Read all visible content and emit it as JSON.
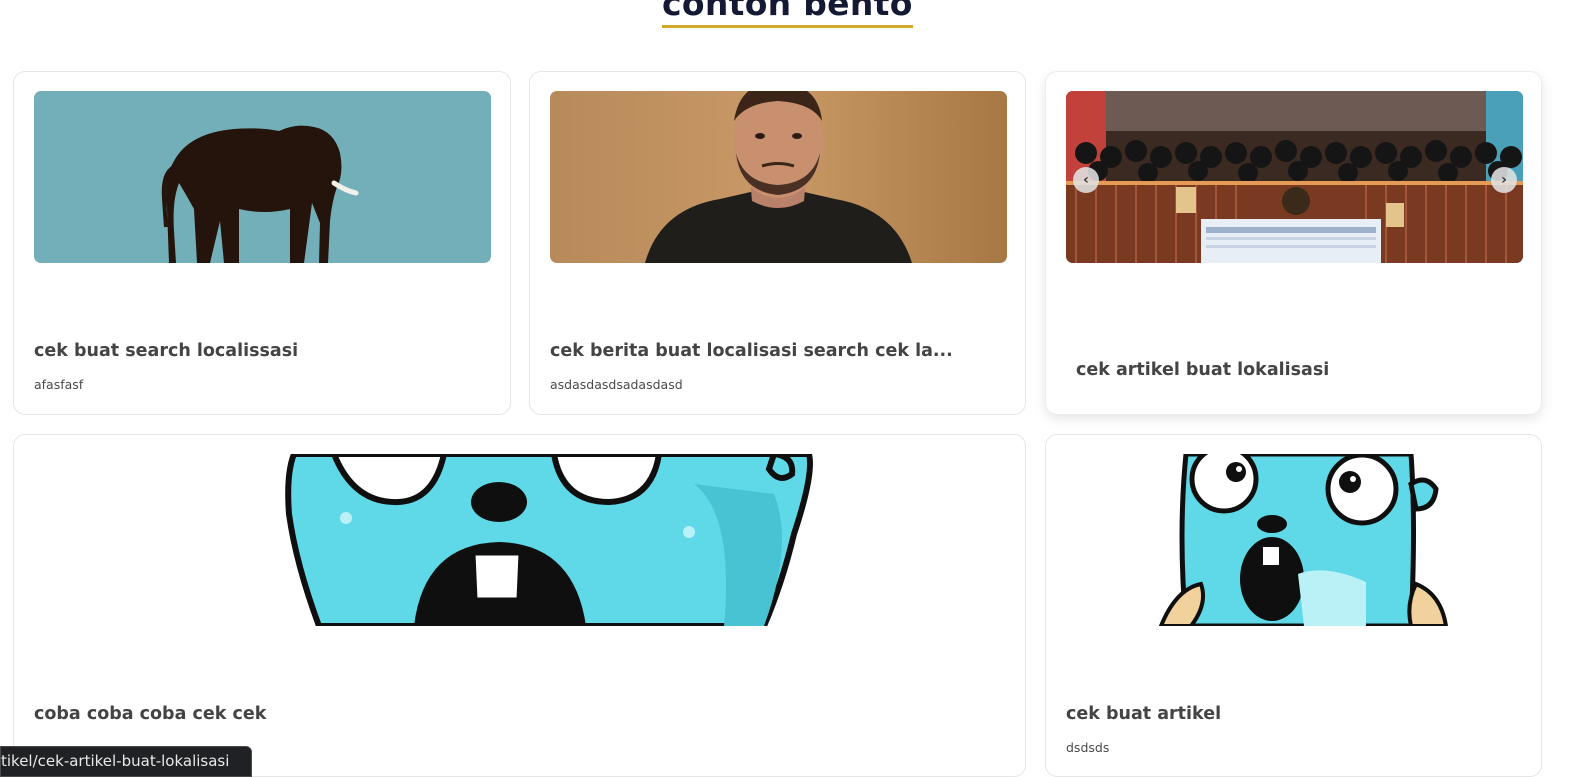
{
  "section": {
    "title": "contoh bento"
  },
  "cards": [
    {
      "title": "cek buat search localissasi",
      "desc": "afasfasf"
    },
    {
      "title": "cek berita buat localisasi search cek la...",
      "desc": "asdasdasdsadasdasd"
    },
    {
      "title": "cek artikel buat lokalisasi",
      "desc": ""
    },
    {
      "title": "coba coba coba cek cek",
      "desc": ""
    },
    {
      "title": "cek buat artikel",
      "desc": "dsdsds"
    }
  ],
  "carousel": {
    "prev_icon": "chevron-left-icon",
    "next_icon": "chevron-right-icon",
    "prev_glyph": "‹",
    "next_glyph": "›"
  },
  "status": {
    "url": "tikel/cek-artikel-buat-lokalisasi"
  },
  "colors": {
    "accent_underline": "#d1aa2b",
    "heading": "#141a33",
    "elephant_bg": "#73afb8",
    "gopher_blue": "#5fd9e8"
  }
}
